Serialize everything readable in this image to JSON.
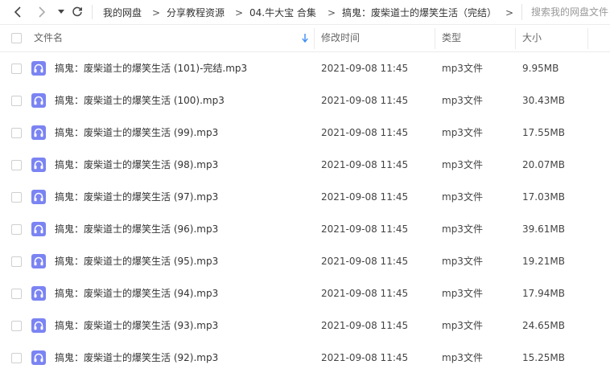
{
  "toolbar": {
    "breadcrumbs": [
      "我的网盘",
      "分享教程资源",
      "04.牛大宝 合集",
      "搞鬼：废柴道士的爆笑生活（完结）"
    ],
    "separator": ">",
    "search_placeholder": "搜索我的网盘文件"
  },
  "header": {
    "name": "文件名",
    "modified": "修改时间",
    "type": "类型",
    "size": "大小"
  },
  "files": [
    {
      "name": "搞鬼：废柴道士的爆笑生活 (101)-完结.mp3",
      "date": "2021-09-08 11:45",
      "type": "mp3文件",
      "size": "9.95MB"
    },
    {
      "name": "搞鬼：废柴道士的爆笑生活 (100).mp3",
      "date": "2021-09-08 11:45",
      "type": "mp3文件",
      "size": "30.43MB"
    },
    {
      "name": "搞鬼：废柴道士的爆笑生活 (99).mp3",
      "date": "2021-09-08 11:45",
      "type": "mp3文件",
      "size": "17.55MB"
    },
    {
      "name": "搞鬼：废柴道士的爆笑生活 (98).mp3",
      "date": "2021-09-08 11:45",
      "type": "mp3文件",
      "size": "20.07MB"
    },
    {
      "name": "搞鬼：废柴道士的爆笑生活 (97).mp3",
      "date": "2021-09-08 11:45",
      "type": "mp3文件",
      "size": "17.03MB"
    },
    {
      "name": "搞鬼：废柴道士的爆笑生活 (96).mp3",
      "date": "2021-09-08 11:45",
      "type": "mp3文件",
      "size": "39.61MB"
    },
    {
      "name": "搞鬼：废柴道士的爆笑生活 (95).mp3",
      "date": "2021-09-08 11:45",
      "type": "mp3文件",
      "size": "19.21MB"
    },
    {
      "name": "搞鬼：废柴道士的爆笑生活 (94).mp3",
      "date": "2021-09-08 11:45",
      "type": "mp3文件",
      "size": "17.94MB"
    },
    {
      "name": "搞鬼：废柴道士的爆笑生活 (93).mp3",
      "date": "2021-09-08 11:45",
      "type": "mp3文件",
      "size": "24.65MB"
    },
    {
      "name": "搞鬼：废柴道士的爆笑生活 (92).mp3",
      "date": "2021-09-08 11:45",
      "type": "mp3文件",
      "size": "15.25MB"
    }
  ],
  "icons": {
    "back": "chevron-left-icon",
    "forward": "chevron-right-icon",
    "history": "caret-down-icon",
    "refresh": "refresh-icon",
    "sort": "sort-arrow-down-icon",
    "file": "audio-file-icon"
  },
  "colors": {
    "file_icon": "#7b84f2",
    "sort_arrow": "#3b8cf5"
  }
}
